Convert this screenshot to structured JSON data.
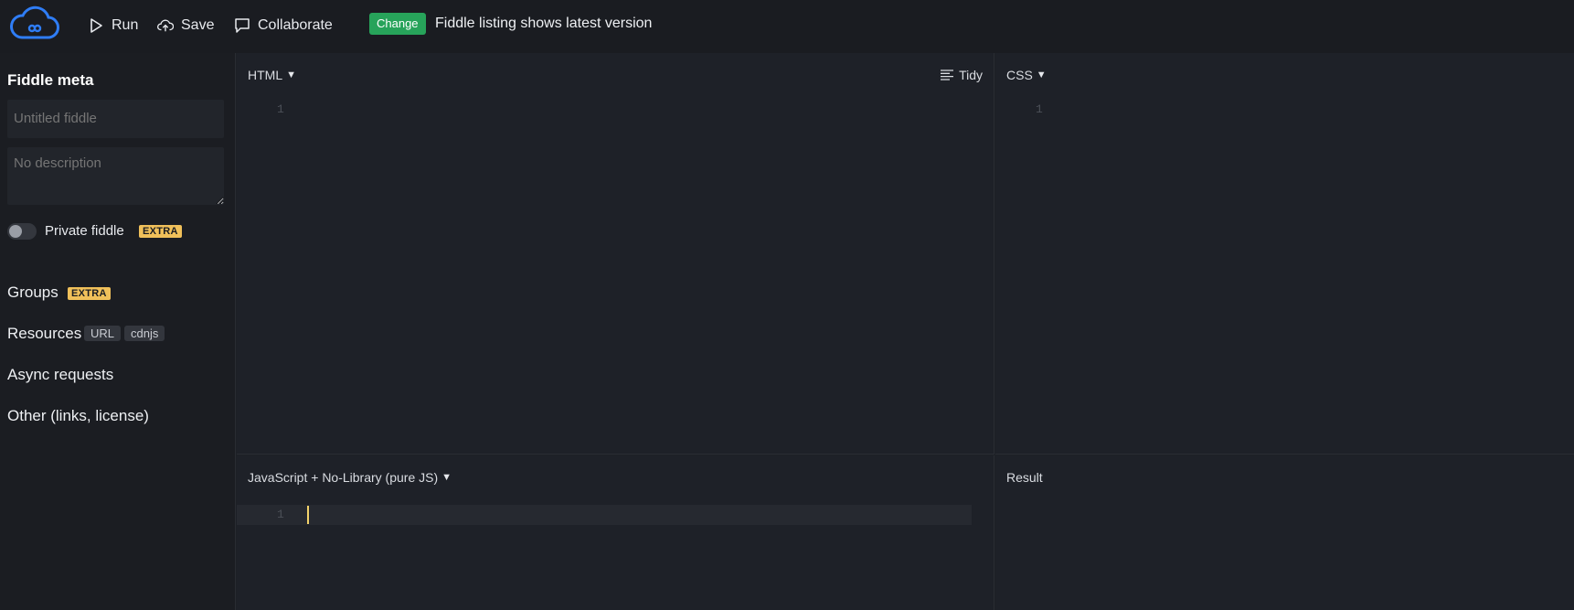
{
  "topbar": {
    "run_label": "Run",
    "save_label": "Save",
    "collaborate_label": "Collaborate",
    "change_badge": "Change",
    "change_text": "Fiddle listing shows latest version"
  },
  "sidebar": {
    "title": "Fiddle meta",
    "title_placeholder": "Untitled fiddle",
    "description_placeholder": "No description",
    "private_label": "Private fiddle",
    "extra_badge": "EXTRA",
    "groups_label": "Groups",
    "resources_label": "Resources",
    "resources_tags": [
      "URL",
      "cdnjs"
    ],
    "async_label": "Async requests",
    "other_label": "Other (links, license)"
  },
  "panels": {
    "html_label": "HTML",
    "tidy_label": "Tidy",
    "css_label": "CSS",
    "js_label": "JavaScript + No-Library (pure JS)",
    "result_label": "Result",
    "line_number": "1"
  },
  "colors": {
    "accent_blue": "#2f7df6",
    "change_green": "#27a35a",
    "extra_yellow": "#f0c05a",
    "cursor_yellow": "#f3d36b"
  }
}
